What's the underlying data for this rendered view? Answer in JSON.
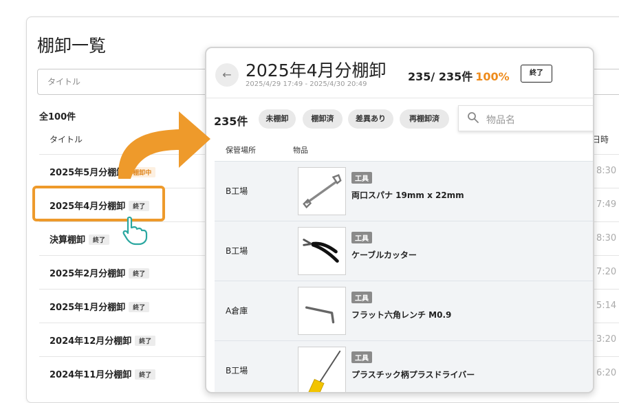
{
  "list_page": {
    "title": "棚卸一覧",
    "search_placeholder": "タイトル",
    "total_count": "全100件",
    "columns": {
      "title": "タイトル",
      "date": "日時"
    },
    "rows": [
      {
        "name": "2025年5月分棚卸",
        "badge": "棚卸中",
        "date": "8:30 -"
      },
      {
        "name": "2025年4月分棚卸",
        "badge": "終了",
        "date": "7:49 -"
      },
      {
        "name": "決算棚卸",
        "badge": "終了",
        "date": "8:30 -"
      },
      {
        "name": "2025年2月分棚卸",
        "badge": "終了",
        "date": "7:20 -"
      },
      {
        "name": "2025年1月分棚卸",
        "badge": "終了",
        "date": "5:14 -"
      },
      {
        "name": "2024年12月分棚卸",
        "badge": "終了",
        "date": "3:20"
      },
      {
        "name": "2024年11月分棚卸",
        "badge": "終了",
        "date": "6:20"
      }
    ]
  },
  "detail_page": {
    "title": "2025年4月分棚卸",
    "period": "2025/4/29 17:49 - 2025/4/30 20:49",
    "progress": "235/ 235件",
    "progress_pct": "100%",
    "status": "終了",
    "item_count": "235件",
    "filters": [
      "未棚卸",
      "棚卸済",
      "差異あり",
      "再棚卸済"
    ],
    "search_placeholder": "物品名",
    "columns": {
      "location": "保管場所",
      "item": "物品"
    },
    "items": [
      {
        "location": "B工場",
        "category": "工具",
        "name": "両口スパナ 19mm x 22mm",
        "icon": "wrench-icon"
      },
      {
        "location": "B工場",
        "category": "工具",
        "name": "ケーブルカッター",
        "icon": "cable-cutter-icon"
      },
      {
        "location": "A倉庫",
        "category": "工具",
        "name": "フラット六角レンチ M0.9",
        "icon": "hex-key-icon"
      },
      {
        "location": "B工場",
        "category": "工具",
        "name": "プラスチック柄プラスドライバー",
        "icon": "screwdriver-icon"
      }
    ]
  },
  "colors": {
    "accent": "#ee9a2b",
    "progress_pct": "#ee8b1c",
    "row_bg": "#f2f4f6"
  }
}
